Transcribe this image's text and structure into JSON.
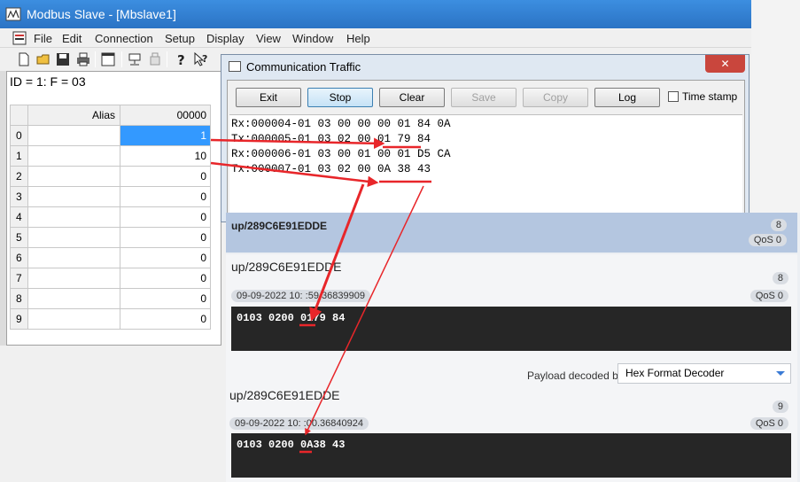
{
  "main_window": {
    "title": "Modbus Slave - [Mbslave1]",
    "menu": [
      "File",
      "Edit",
      "Connection",
      "Setup",
      "Display",
      "View",
      "Window",
      "Help"
    ],
    "id_line": "ID = 1: F = 03",
    "grid": {
      "headers": [
        "Alias",
        "00000"
      ],
      "rows": [
        {
          "index": "0",
          "alias": "",
          "value": "1"
        },
        {
          "index": "1",
          "alias": "",
          "value": "10"
        },
        {
          "index": "2",
          "alias": "",
          "value": "0"
        },
        {
          "index": "3",
          "alias": "",
          "value": "0"
        },
        {
          "index": "4",
          "alias": "",
          "value": "0"
        },
        {
          "index": "5",
          "alias": "",
          "value": "0"
        },
        {
          "index": "6",
          "alias": "",
          "value": "0"
        },
        {
          "index": "7",
          "alias": "",
          "value": "0"
        },
        {
          "index": "8",
          "alias": "",
          "value": "0"
        },
        {
          "index": "9",
          "alias": "",
          "value": "0"
        }
      ]
    }
  },
  "traffic_window": {
    "title": "Communication Traffic",
    "close_label": "✕",
    "buttons": {
      "exit": "Exit",
      "stop": "Stop",
      "clear": "Clear",
      "save": "Save",
      "copy": "Copy",
      "log": "Log"
    },
    "timestamp_label": "Time stamp",
    "log_lines": [
      "Rx:000004-01 03 00 00 00 01 84 0A",
      "Tx:000005-01 03 02 00 01 79 84",
      "Rx:000006-01 03 00 01 00 01 D5 CA",
      "Tx:000007-01 03 02 00 0A 38 43"
    ]
  },
  "mqtt": {
    "highlight": {
      "topic": "up/289C6E91EDDE",
      "count": "8",
      "qos": "QoS 0"
    },
    "messages": [
      {
        "topic": "up/289C6E91EDDE",
        "count": "8",
        "timestamp": "09-09-2022  10:  :59.36839909",
        "qos": "QoS 0",
        "payload": "0103 0200 0179 84"
      },
      {
        "topic": "up/289C6E91EDDE",
        "count": "9",
        "timestamp": "09-09-2022  10:  :00.36840924",
        "qos": "QoS 0",
        "payload": "0103 0200 0A38 43"
      }
    ],
    "decoder_label": "Payload decoded by",
    "decoder_value": "Hex Format Decoder"
  },
  "colors": {
    "annotation": "#e8262a",
    "selection": "#3399ff",
    "titlebar": "#2b73c4"
  }
}
